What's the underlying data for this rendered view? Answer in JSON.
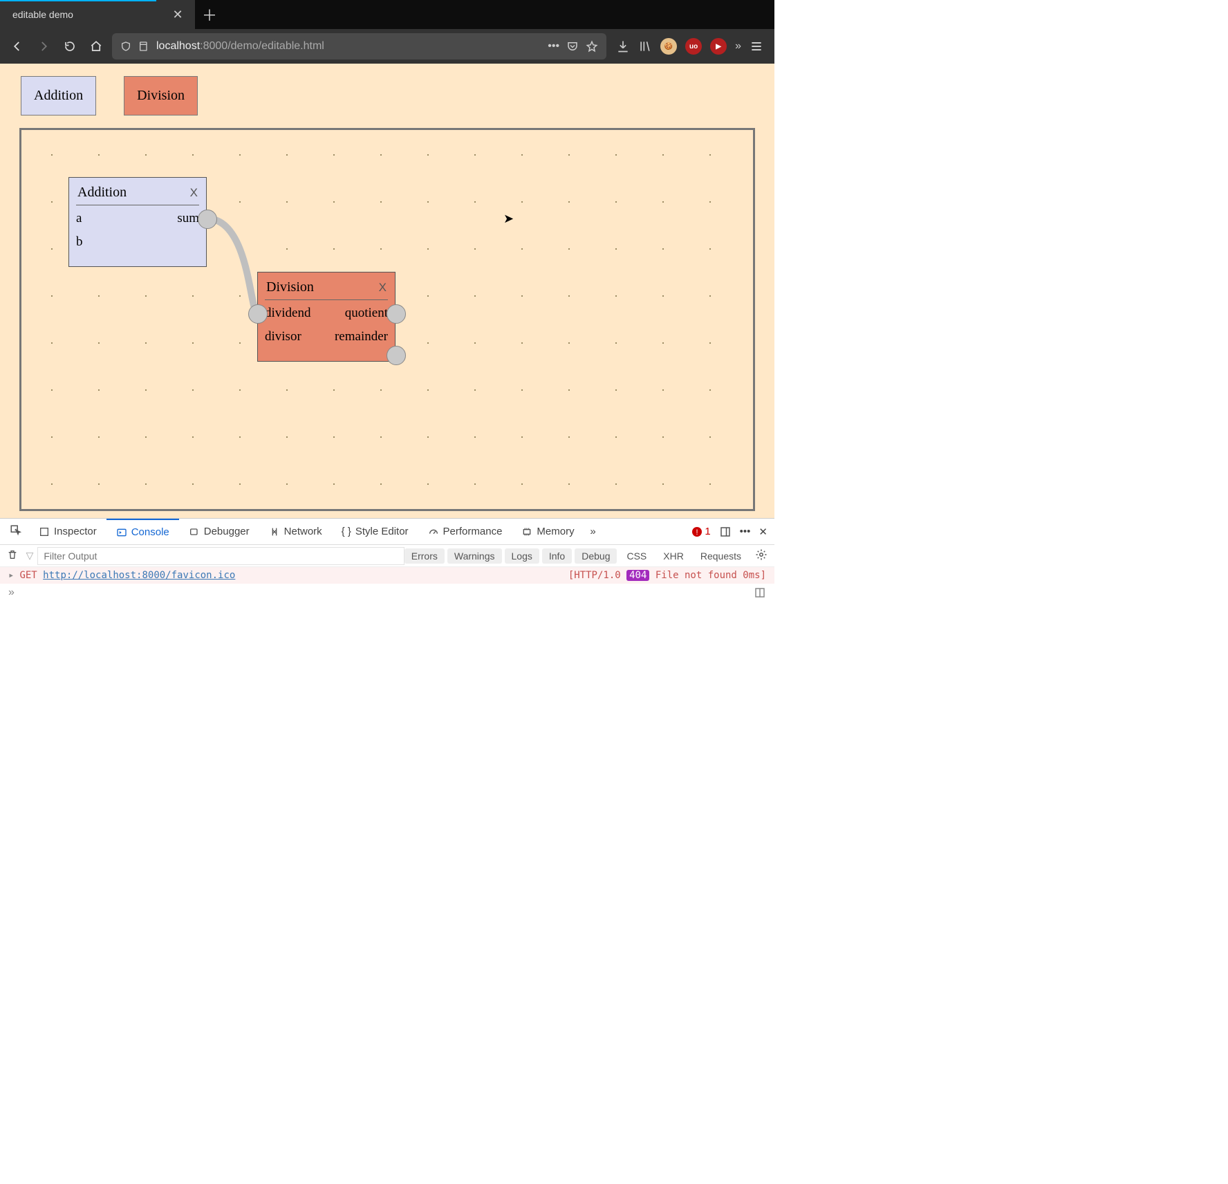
{
  "browser": {
    "tab_title": "editable demo",
    "url_host": "localhost",
    "url_port": ":8000",
    "url_path": "/demo/editable.html"
  },
  "palette": {
    "addition": "Addition",
    "division": "Division"
  },
  "nodes": {
    "addition": {
      "title": "Addition",
      "close": "X",
      "in1": "a",
      "in2": "b",
      "out1": "sum"
    },
    "division": {
      "title": "Division",
      "close": "X",
      "in1": "dividend",
      "in2": "divisor",
      "out1": "quotient",
      "out2": "remainder"
    }
  },
  "devtools": {
    "tabs": {
      "inspector": "Inspector",
      "console": "Console",
      "debugger": "Debugger",
      "network": "Network",
      "style": "Style Editor",
      "perf": "Performance",
      "memory": "Memory"
    },
    "error_count": "1",
    "filter_placeholder": "Filter Output",
    "pills": {
      "errors": "Errors",
      "warnings": "Warnings",
      "logs": "Logs",
      "info": "Info",
      "debug": "Debug"
    },
    "toggles": {
      "css": "CSS",
      "xhr": "XHR",
      "requests": "Requests"
    },
    "log": {
      "method": "GET",
      "url": "http://localhost:8000/favicon.ico",
      "resp_prefix": "[HTTP/1.0 ",
      "code": "404",
      "resp_suffix": " File not found 0ms]"
    }
  }
}
